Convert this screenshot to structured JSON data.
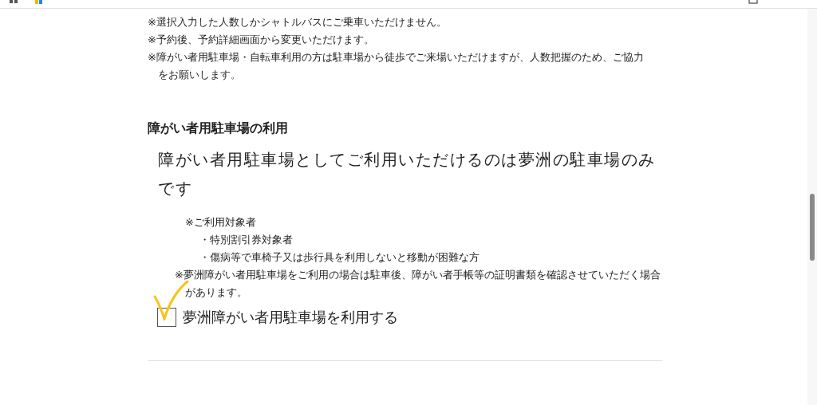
{
  "notes": [
    "※選択入力した人数しかシャトルバスにご乗車いただけません。",
    "※予約後、予約詳細画面から変更いただけます。",
    "※障がい者用駐車場・自転車利用の方は駐車場から徒歩でご来場いただけますが、人数把握のため、ご協力をお願いします。"
  ],
  "section": {
    "heading": "障がい者用駐車場の利用",
    "lead": "障がい者用駐車場としてご利用いただけるのは夢洲の駐車場のみです",
    "eligibility_title": "※ご利用対象者",
    "eligibility": [
      "・特別割引券対象者",
      "・傷病等で車椅子又は歩行具を利用しないと移動が困難な方"
    ],
    "notice": "※夢洲障がい者用駐車場をご利用の場合は駐車後、障がい者手帳等の証明書類を確認させていただく場合があります。",
    "checkbox": {
      "label": "夢洲障がい者用駐車場を利用する",
      "checked": true
    }
  }
}
